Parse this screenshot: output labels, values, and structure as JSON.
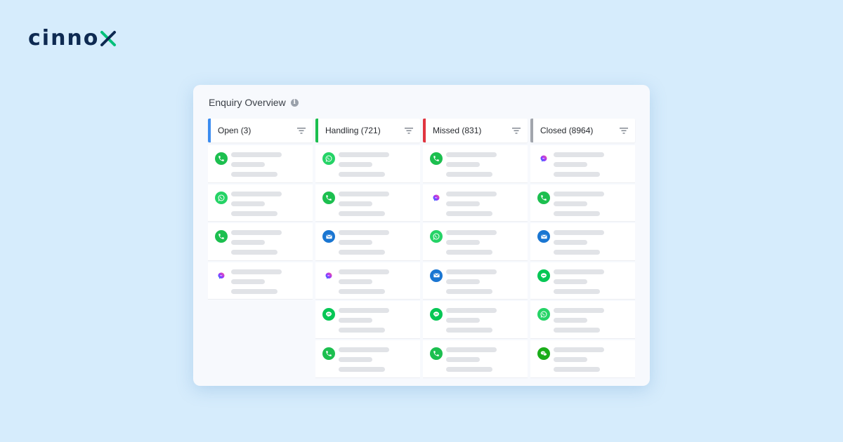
{
  "brand": {
    "name": "cinno",
    "accent_color": "#00c07a",
    "dark_color": "#0e2a52"
  },
  "panel": {
    "title": "Enquiry Overview",
    "info_icon": "info-icon"
  },
  "columns": [
    {
      "title": "Open (3)",
      "accent": "#3b8cf0",
      "cards": [
        "phone",
        "whatsapp",
        "phone",
        "messenger"
      ]
    },
    {
      "title": "Handling (721)",
      "accent": "#1cbf4f",
      "cards": [
        "whatsapp",
        "phone",
        "email",
        "messenger",
        "line",
        "phone"
      ]
    },
    {
      "title": "Missed (831)",
      "accent": "#e0343f",
      "cards": [
        "phone",
        "messenger",
        "whatsapp",
        "email",
        "line",
        "phone"
      ]
    },
    {
      "title": "Closed (8964)",
      "accent": "#a2a6ad",
      "cards": [
        "messenger",
        "phone",
        "email",
        "line",
        "whatsapp",
        "wechat"
      ]
    }
  ],
  "icon_colors": {
    "phone": "#1cbf4f",
    "whatsapp": "#25d366",
    "line": "#06c755",
    "wechat": "#1aad19",
    "email": "#1a76d2",
    "messenger": "#ffffff"
  }
}
